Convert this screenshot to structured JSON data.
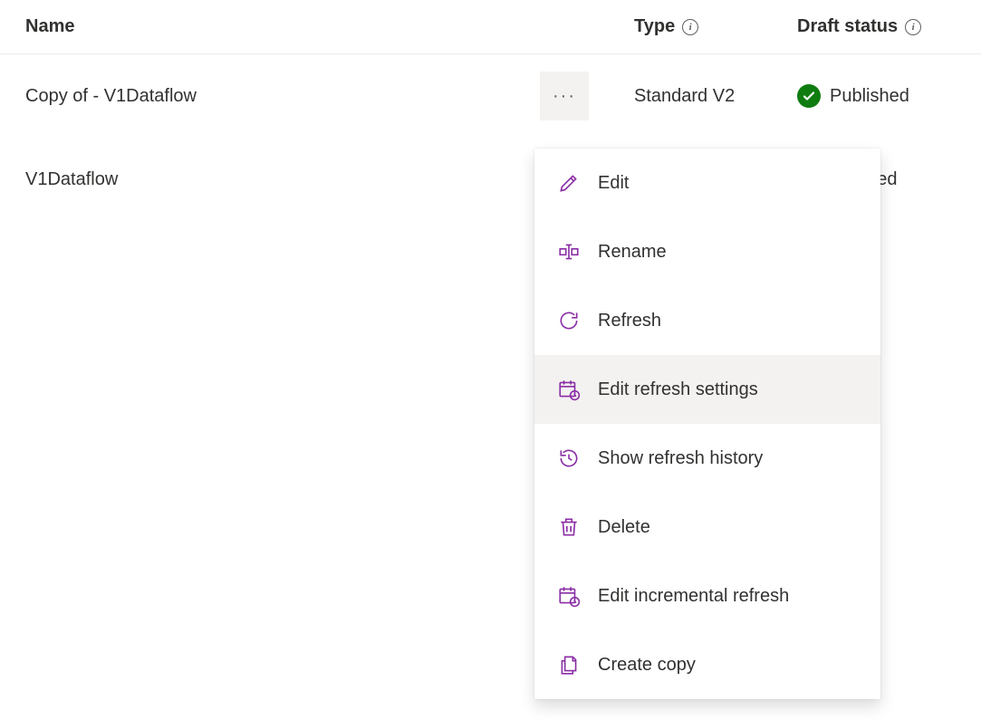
{
  "columns": {
    "name": "Name",
    "type": "Type",
    "status": "Draft status"
  },
  "rows": [
    {
      "name": "Copy of - V1Dataflow",
      "type": "Standard V2",
      "status": "Published",
      "menu_open": true
    },
    {
      "name": "V1Dataflow",
      "type": "",
      "status": "ublished",
      "menu_open": false
    }
  ],
  "menu": {
    "items": [
      {
        "label": "Edit",
        "icon": "edit-icon",
        "highlighted": false
      },
      {
        "label": "Rename",
        "icon": "rename-icon",
        "highlighted": false
      },
      {
        "label": "Refresh",
        "icon": "refresh-icon",
        "highlighted": false
      },
      {
        "label": "Edit refresh settings",
        "icon": "calendar-clock-icon",
        "highlighted": true
      },
      {
        "label": "Show refresh history",
        "icon": "history-icon",
        "highlighted": false
      },
      {
        "label": "Delete",
        "icon": "delete-icon",
        "highlighted": false
      },
      {
        "label": "Edit incremental refresh",
        "icon": "calendar-clock-icon",
        "highlighted": false
      },
      {
        "label": "Create copy",
        "icon": "copy-icon",
        "highlighted": false
      }
    ]
  }
}
